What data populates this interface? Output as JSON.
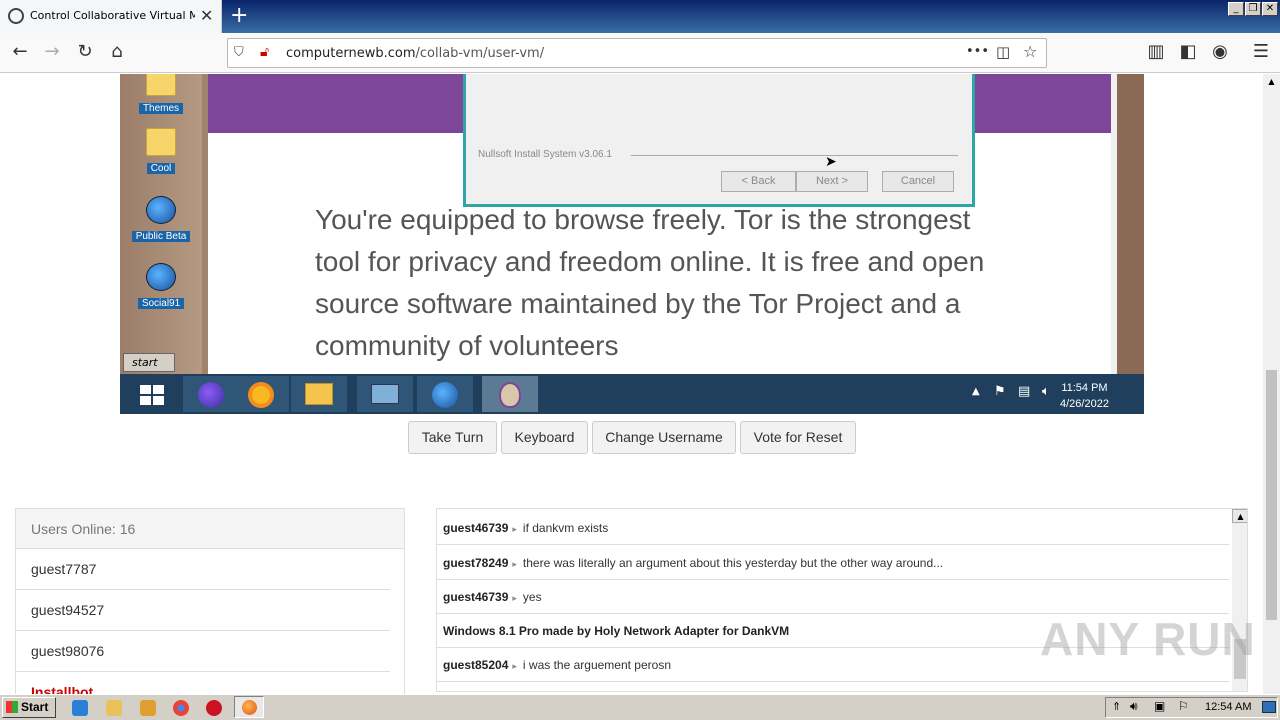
{
  "browser": {
    "tab_title": "Control Collaborative Virtual Machi",
    "new_tab_icon": "plus-icon",
    "url_host": "computernewb.com",
    "url_path": "/collab-vm/user-vm/",
    "page_actions": "•••"
  },
  "vm": {
    "desktop_icons": [
      {
        "label": "Themes"
      },
      {
        "label": "Cool"
      },
      {
        "label": "Public Beta"
      },
      {
        "label": "Social91"
      }
    ],
    "installer": {
      "branding": "Nullsoft Install System v3.06.1",
      "back": "< Back",
      "next": "Next >",
      "cancel": "Cancel"
    },
    "tor_text": "You're equipped to browse freely. Tor is the strongest tool for privacy and freedom online. It is free and open source software maintained by the Tor Project and a community of volunteers",
    "start_label": "start",
    "clock_time": "11:54 PM",
    "clock_date": "4/26/2022"
  },
  "controls": {
    "take_turn": "Take Turn",
    "keyboard": "Keyboard",
    "change_username": "Change Username",
    "vote_reset": "Vote for Reset"
  },
  "users": {
    "header": "Users Online: 16",
    "list": [
      "guest7787",
      "guest94527",
      "guest98076",
      "Installbot"
    ]
  },
  "chat": {
    "messages": [
      {
        "user": "guest46739",
        "text": "if dankvm exists"
      },
      {
        "user": "guest78249",
        "text": "there was literally an argument about this yesterday but the other way around..."
      },
      {
        "user": "guest46739",
        "text": "yes"
      },
      {
        "user": "",
        "text": "Windows 8.1 Pro made by Holy Network Adapter for DankVM"
      },
      {
        "user": "guest85204",
        "text": "i was the arguement perosn"
      }
    ]
  },
  "watermark": "ANY RUN",
  "host": {
    "start_label": "Start",
    "clock": "12:54 AM"
  },
  "colors": {
    "tor_purple": "#7d4698",
    "vm_taskbar": "#1f3f5c",
    "installer_border": "#2ea6a6"
  }
}
